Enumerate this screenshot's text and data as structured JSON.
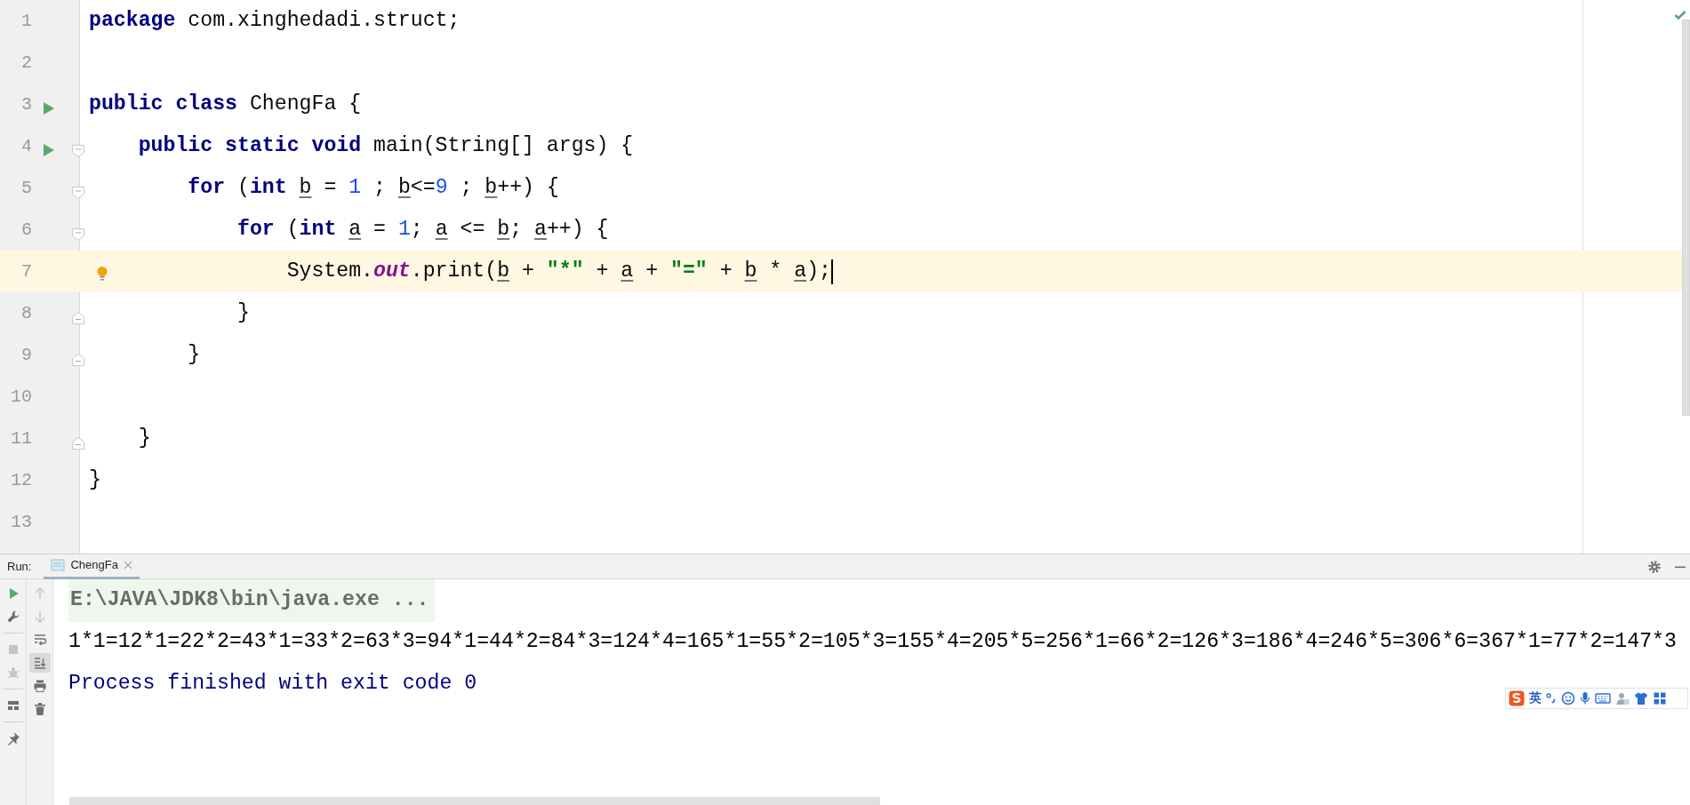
{
  "editor": {
    "lines": [
      {
        "number": "1",
        "runnable": false,
        "current": false,
        "tokens": [
          {
            "kind": "kw",
            "text": "package"
          },
          {
            "kind": "txt",
            "text": " com.xinghedadi.struct;"
          }
        ]
      },
      {
        "number": "2",
        "runnable": false,
        "current": false
      },
      {
        "number": "3",
        "runnable": true,
        "current": false,
        "tokens": [
          {
            "kind": "kw",
            "text": "public class"
          },
          {
            "kind": "txt",
            "text": " ChengFa {"
          }
        ],
        "children": [
          {
            "number": "4",
            "runnable": true,
            "current": false,
            "fold_start": true,
            "tokens": [
              {
                "kind": "kw",
                "text": "public static void"
              },
              {
                "kind": "txt",
                "text": " main(String[] args) {"
              }
            ],
            "children": [
              {
                "number": "5",
                "runnable": false,
                "current": false,
                "fold_start": true,
                "tokens": [
                  {
                    "kind": "kw",
                    "text": "for"
                  },
                  {
                    "kind": "txt",
                    "text": " ("
                  },
                  {
                    "kind": "kw",
                    "text": "int "
                  },
                  {
                    "kind": "var",
                    "text": "b"
                  },
                  {
                    "kind": "txt",
                    "text": " = "
                  },
                  {
                    "kind": "num",
                    "text": "1"
                  },
                  {
                    "kind": "txt",
                    "text": " ; "
                  },
                  {
                    "kind": "var",
                    "text": "b"
                  },
                  {
                    "kind": "txt",
                    "text": "<="
                  },
                  {
                    "kind": "num",
                    "text": "9"
                  },
                  {
                    "kind": "txt",
                    "text": " ; "
                  },
                  {
                    "kind": "var",
                    "text": "b"
                  },
                  {
                    "kind": "txt",
                    "text": "++) {"
                  }
                ],
                "children": [
                  {
                    "number": "6",
                    "runnable": false,
                    "current": false,
                    "fold_start": true,
                    "tokens": [
                      {
                        "kind": "kw",
                        "text": "for"
                      },
                      {
                        "kind": "txt",
                        "text": " ("
                      },
                      {
                        "kind": "kw",
                        "text": "int "
                      },
                      {
                        "kind": "var",
                        "text": "a"
                      },
                      {
                        "kind": "txt",
                        "text": " = "
                      },
                      {
                        "kind": "num",
                        "text": "1"
                      },
                      {
                        "kind": "txt",
                        "text": "; "
                      },
                      {
                        "kind": "var",
                        "text": "a"
                      },
                      {
                        "kind": "txt",
                        "text": " <= "
                      },
                      {
                        "kind": "var",
                        "text": "b"
                      },
                      {
                        "kind": "txt",
                        "text": "; "
                      },
                      {
                        "kind": "var",
                        "text": "a"
                      },
                      {
                        "kind": "txt",
                        "text": "++) {"
                      }
                    ],
                    "children": [
                      {
                        "number": "7",
                        "runnable": false,
                        "current": true,
                        "bulb": true,
                        "caret": true,
                        "tokens": [
                          {
                            "kind": "txt",
                            "text": "System."
                          },
                          {
                            "kind": "field",
                            "text": "out"
                          },
                          {
                            "kind": "txt",
                            "text": ".print("
                          },
                          {
                            "kind": "var",
                            "text": "b"
                          },
                          {
                            "kind": "txt",
                            "text": " + "
                          },
                          {
                            "kind": "str",
                            "text": "\"*\""
                          },
                          {
                            "kind": "txt",
                            "text": " + "
                          },
                          {
                            "kind": "var",
                            "text": "a"
                          },
                          {
                            "kind": "txt",
                            "text": " + "
                          },
                          {
                            "kind": "str",
                            "text": "\"=\""
                          },
                          {
                            "kind": "txt",
                            "text": " + "
                          },
                          {
                            "kind": "var",
                            "text": "b"
                          },
                          {
                            "kind": "txt",
                            "text": " * "
                          },
                          {
                            "kind": "var",
                            "text": "a"
                          },
                          {
                            "kind": "txt",
                            "text": ");"
                          }
                        ]
                      }
                    ]
                  },
                  {
                    "number": "8",
                    "runnable": false,
                    "current": false,
                    "fold_end": true,
                    "tokens": [
                      {
                        "kind": "txt",
                        "text": "}"
                      }
                    ]
                  }
                ]
              },
              {
                "number": "9",
                "runnable": false,
                "current": false,
                "fold_end": true,
                "tokens": [
                  {
                    "kind": "txt",
                    "text": "}"
                  }
                ]
              },
              {
                "number": "10",
                "runnable": false,
                "current": false
              }
            ]
          },
          {
            "number": "11",
            "runnable": false,
            "current": false,
            "fold_end": true,
            "tokens": [
              {
                "kind": "txt",
                "text": "}"
              }
            ]
          }
        ]
      },
      {
        "number": "12",
        "runnable": false,
        "current": false,
        "tokens": [
          {
            "kind": "txt",
            "text": "}"
          }
        ]
      },
      {
        "number": "13",
        "runnable": false,
        "current": false
      }
    ]
  },
  "run_panel": {
    "label": "Run:",
    "tabs": [
      {
        "label": "ChengFa",
        "selected": true
      }
    ],
    "toolbar_left": [
      {
        "kind": "run",
        "disabled": false,
        "selected": false
      },
      {
        "kind": "wrench",
        "disabled": false,
        "selected": false
      },
      {
        "kind": "separator"
      },
      {
        "kind": "stop",
        "disabled": true,
        "selected": false
      },
      {
        "kind": "bug",
        "disabled": true,
        "selected": false
      },
      {
        "kind": "separator"
      },
      {
        "kind": "layout",
        "disabled": false,
        "selected": false
      },
      {
        "kind": "separator"
      },
      {
        "kind": "pin",
        "disabled": false,
        "selected": false
      }
    ],
    "toolbar_right": [
      {
        "kind": "up",
        "disabled": true,
        "selected": false
      },
      {
        "kind": "down",
        "disabled": true,
        "selected": false
      },
      {
        "kind": "wrap",
        "disabled": false,
        "selected": false
      },
      {
        "kind": "scroll-end",
        "disabled": false,
        "selected": true
      },
      {
        "kind": "print",
        "disabled": false,
        "selected": false
      },
      {
        "kind": "trash",
        "disabled": false,
        "selected": false
      }
    ],
    "console": [
      {
        "kind": "command",
        "text": "E:\\JAVA\\JDK8\\bin\\java.exe ..."
      },
      {
        "kind": "stdout",
        "text": "1*1=12*1=22*2=43*1=33*2=63*3=94*1=44*2=84*3=124*4=165*1=55*2=105*3=155*4=205*5=256*1=66*2=126*3=186*4=246*5=306*6=367*1=77*2=147*3"
      },
      {
        "kind": "exit",
        "text": "Process finished with exit code 0"
      }
    ]
  },
  "ime_toolbar": {
    "mode": "英"
  }
}
